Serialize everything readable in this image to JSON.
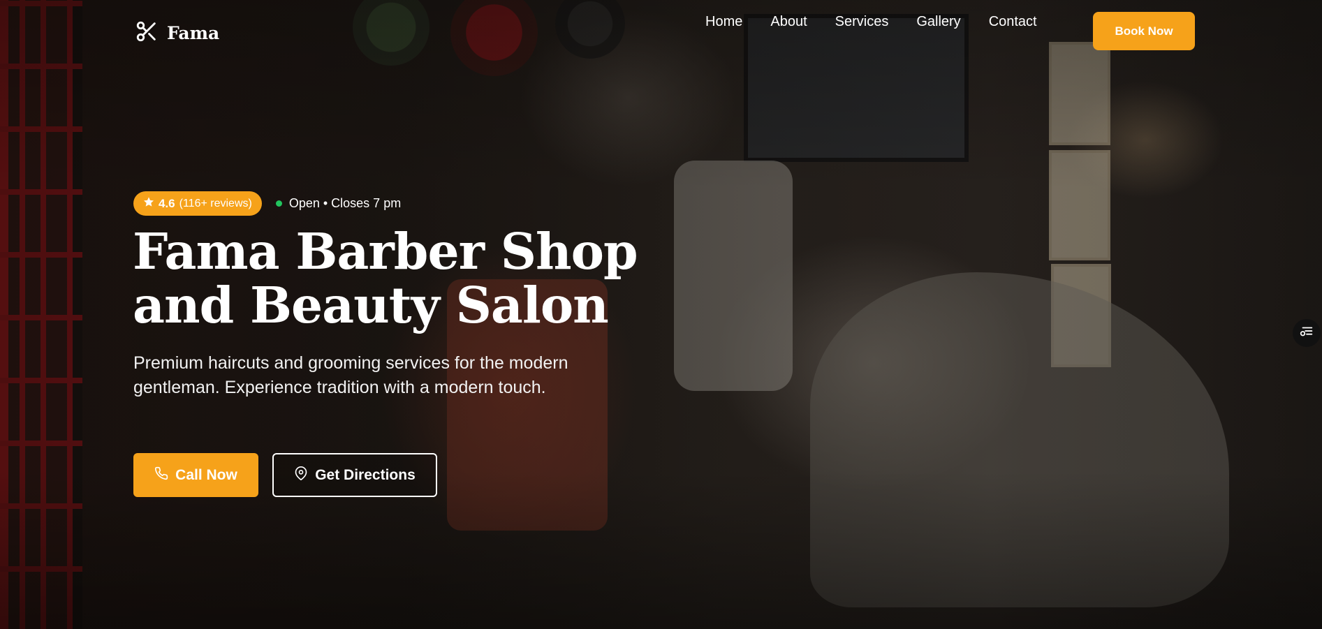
{
  "brand": {
    "name": "Fama",
    "icon": "scissors-icon"
  },
  "nav": {
    "items": [
      {
        "label": "Home"
      },
      {
        "label": "About"
      },
      {
        "label": "Services"
      },
      {
        "label": "Gallery"
      },
      {
        "label": "Contact"
      }
    ],
    "cta_label": "Book Now"
  },
  "hero": {
    "rating": {
      "value": "4.6",
      "reviews": "(116+ reviews)",
      "icon": "star-icon"
    },
    "status": "Open • Closes 7 pm",
    "title": "Fama Barber Shop and Beauty Salon",
    "subtitle": "Premium haircuts and grooming services for the modern gentleman. Experience tradition with a modern touch.",
    "call_label": "Call Now",
    "directions_label": "Get Directions"
  },
  "colors": {
    "accent": "#f6a21a",
    "status_open": "#22c55e"
  }
}
